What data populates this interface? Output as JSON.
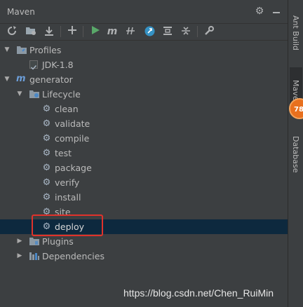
{
  "panel": {
    "title": "Maven"
  },
  "header_icons": {
    "settings": "gear-icon",
    "hide": "minimize-icon"
  },
  "toolbar": {
    "buttons": [
      {
        "name": "reload-icon"
      },
      {
        "name": "generate-sources-icon"
      },
      {
        "name": "download-icon"
      },
      {
        "name": "add-icon"
      },
      {
        "name": "run-icon"
      },
      {
        "name": "execute-goal-icon"
      },
      {
        "name": "toggle-offline-icon"
      },
      {
        "name": "skip-tests-icon"
      },
      {
        "name": "show-dependencies-icon"
      },
      {
        "name": "collapse-all-icon"
      },
      {
        "name": "settings-wrench-icon"
      }
    ]
  },
  "tree": {
    "profiles": {
      "label": "Profiles",
      "items": [
        {
          "label": "JDK-1.8",
          "checked": true
        }
      ]
    },
    "project": {
      "label": "generator"
    },
    "lifecycle": {
      "label": "Lifecycle",
      "goals": [
        "clean",
        "validate",
        "compile",
        "test",
        "package",
        "verify",
        "install",
        "site",
        "deploy"
      ]
    },
    "plugins": {
      "label": "Plugins"
    },
    "dependencies": {
      "label": "Dependencies"
    }
  },
  "selected_goal": "deploy",
  "side_tabs": {
    "ant": "Ant Build",
    "maven": "Maven",
    "database": "Database"
  },
  "badge": {
    "value": "78"
  },
  "watermark": "https://blog.csdn.net/Chen_RuiMin",
  "colors": {
    "selection": "#0d293e",
    "highlight": "#e0322b",
    "run": "#59a869",
    "badge": "#e8701e"
  }
}
